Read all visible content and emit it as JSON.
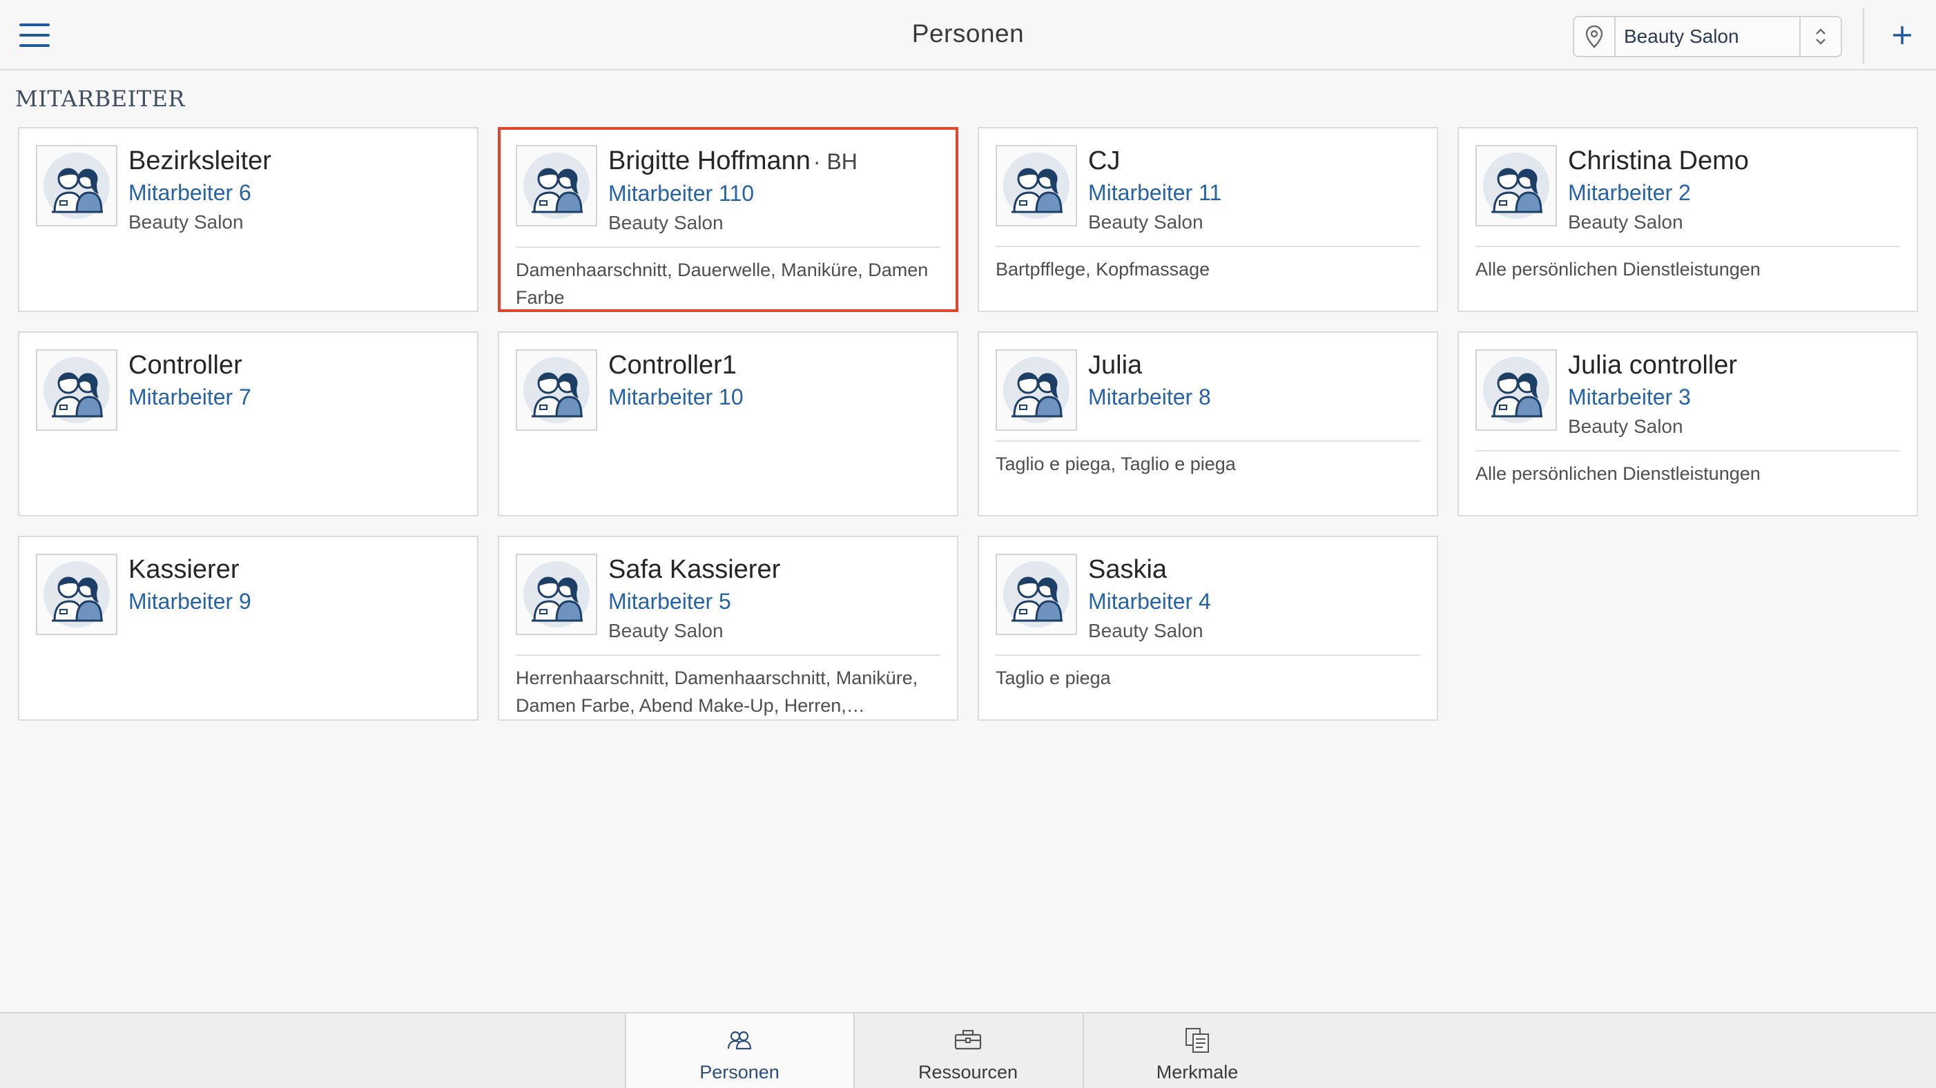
{
  "header": {
    "title": "Personen",
    "location": "Beauty Salon",
    "menu_icon": "hamburger-menu-icon",
    "add_icon": "plus-icon"
  },
  "section": {
    "title": "MITARBEITER"
  },
  "employees": [
    {
      "name": "Bezirksleiter",
      "initials": "",
      "role": "Mitarbeiter 6",
      "location": "Beauty Salon",
      "services": ""
    },
    {
      "name": "Brigitte Hoffmann",
      "initials": "· BH",
      "role": "Mitarbeiter 110",
      "location": "Beauty Salon",
      "services": "Damenhaarschnitt, Dauerwelle, Maniküre, Damen Farbe",
      "selected": true
    },
    {
      "name": "CJ",
      "initials": "",
      "role": "Mitarbeiter 11",
      "location": "Beauty Salon",
      "services": "Bartpfflege, Kopfmassage"
    },
    {
      "name": "Christina Demo",
      "initials": "",
      "role": "Mitarbeiter 2",
      "location": "Beauty Salon",
      "services": "Alle persönlichen Dienstleistungen"
    },
    {
      "name": "Controller",
      "initials": "",
      "role": "Mitarbeiter 7",
      "location": "",
      "services": ""
    },
    {
      "name": "Controller1",
      "initials": "",
      "role": "Mitarbeiter 10",
      "location": "",
      "services": ""
    },
    {
      "name": "Julia",
      "initials": "",
      "role": "Mitarbeiter 8",
      "location": "",
      "services": "Taglio e piega, Taglio e piega"
    },
    {
      "name": "Julia controller",
      "initials": "",
      "role": "Mitarbeiter 3",
      "location": "Beauty Salon",
      "services": "Alle persönlichen Dienstleistungen"
    },
    {
      "name": "Kassierer",
      "initials": "",
      "role": "Mitarbeiter 9",
      "location": "",
      "services": ""
    },
    {
      "name": "Safa Kassierer",
      "initials": "",
      "role": "Mitarbeiter 5",
      "location": "Beauty Salon",
      "services": "Herrenhaarschnitt, Damenhaarschnitt, Maniküre, Damen Farbe, Abend Make-Up, Herren, Waschen..."
    },
    {
      "name": "Saskia",
      "initials": "",
      "role": "Mitarbeiter 4",
      "location": "Beauty Salon",
      "services": "Taglio e piega"
    }
  ],
  "tabs": [
    {
      "label": "Personen",
      "icon": "people-icon",
      "active": true
    },
    {
      "label": "Ressourcen",
      "icon": "toolbox-icon",
      "active": false
    },
    {
      "label": "Merkmale",
      "icon": "features-icon",
      "active": false
    }
  ],
  "colors": {
    "accent": "#1f5a9c",
    "selected_border": "#e2452e",
    "role_text": "#2563a6"
  }
}
